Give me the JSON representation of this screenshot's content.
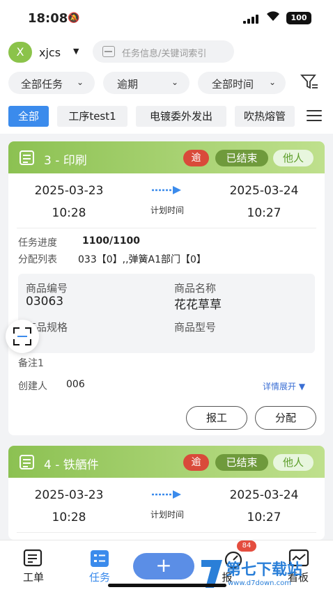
{
  "status": {
    "time": "18:08",
    "battery": "100"
  },
  "header": {
    "avatar_letter": "X",
    "username": "xjcs",
    "search_placeholder": "任务信息/关键词索引"
  },
  "filters": {
    "task": "全部任务",
    "overdue": "逾期",
    "time": "全部时间"
  },
  "chips": [
    "全部",
    "工序test1",
    "电镀委外发出",
    "吹热熔管"
  ],
  "cards": [
    {
      "title": "3 - 印刷",
      "badge_overdue": "逾",
      "badge_ended": "已结束",
      "badge_other": "他人",
      "start_date": "2025-03-23",
      "start_time": "10:28",
      "end_date": "2025-03-24",
      "end_time": "10:27",
      "plan_label": "计划时间",
      "progress_label": "任务进度",
      "progress_value": "1100/1100",
      "progress_fraction": 1.0,
      "assign_label": "分配列表",
      "assign_value": "033【0】,,弹簧A1部门【0】",
      "goods_code_label": "商品编号",
      "goods_code": "03063",
      "goods_name_label": "商品名称",
      "goods_name": "花花草草",
      "goods_spec_label": "商品规格",
      "goods_model_label": "商品型号",
      "remark": "备注1",
      "creator_label": "创建人",
      "creator": "006",
      "more_label": "详情展开",
      "btn_report": "报工",
      "btn_assign": "分配"
    },
    {
      "title": "4 - 铁舾件",
      "badge_overdue": "逾",
      "badge_ended": "已结束",
      "badge_other": "他人",
      "start_date": "2025-03-23",
      "start_time": "10:28",
      "end_date": "2025-03-24",
      "end_time": "10:27",
      "plan_label": "计划时间"
    }
  ],
  "tabs": {
    "work_order": "工单",
    "task": "任务",
    "report": "报",
    "mine": "看板"
  },
  "plus": "+",
  "notif_count": "84",
  "watermark": {
    "text": "第七下载站",
    "url": "www.d7down.com"
  },
  "colors": {
    "accent": "#3b8bec",
    "header_green": "#8cc152",
    "overdue": "#d94a3a"
  }
}
